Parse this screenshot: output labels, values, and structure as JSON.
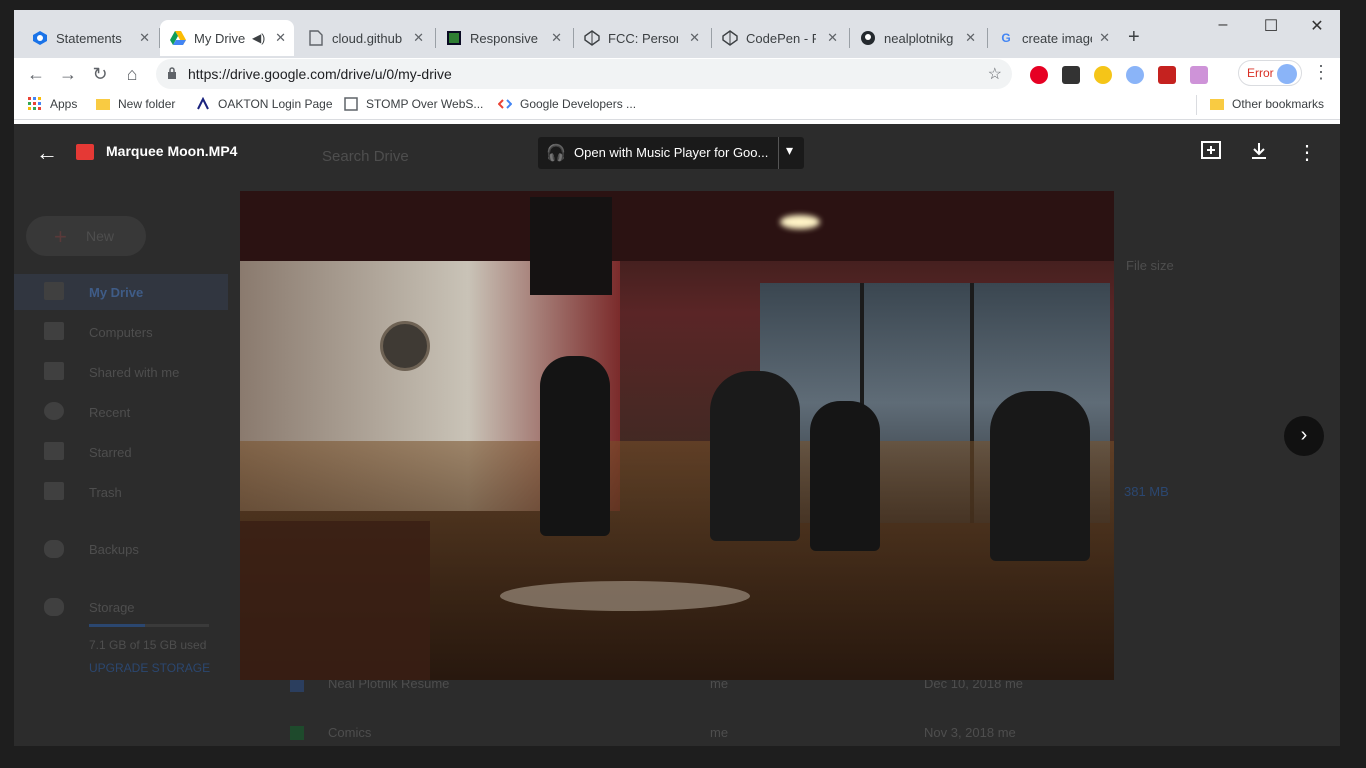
{
  "browser": {
    "tabs": [
      {
        "label": "Statements a",
        "icon": "blue-hex-icon",
        "active": false
      },
      {
        "label": "My Drive",
        "icon": "google-drive-icon",
        "active": true
      },
      {
        "label": "cloud.githubu",
        "icon": "document-icon",
        "active": false
      },
      {
        "label": "Responsive W",
        "icon": "green-square-icon",
        "active": false
      },
      {
        "label": "FCC: Personal",
        "icon": "codepen-icon",
        "active": false
      },
      {
        "label": "CodePen - FC",
        "icon": "codepen-icon",
        "active": false
      },
      {
        "label": "nealplotnikgi",
        "icon": "github-icon",
        "active": false
      },
      {
        "label": "create image",
        "icon": "google-icon",
        "active": false
      }
    ],
    "new_tab": "+",
    "window_controls": {
      "minimize": "–",
      "maximize": "☐",
      "close": "✕"
    },
    "address": "https://drive.google.com/drive/u/0/my-drive",
    "error_chip": "Error",
    "bookmarks": [
      {
        "label": "Apps"
      },
      {
        "label": "New folder"
      },
      {
        "label": "OAKTON Login Page"
      },
      {
        "label": "STOMP Over WebS..."
      },
      {
        "label": "Google Developers ..."
      }
    ],
    "other_bookmarks": "Other bookmarks"
  },
  "viewer": {
    "filename": "Marquee Moon.MP4",
    "open_with": "Open with Music Player for Goo...",
    "icons": {
      "back": "back-arrow-icon",
      "add_to_drive": "add-to-drive-icon",
      "download": "download-icon",
      "more": "more-vert-icon",
      "next": "chevron-right-icon"
    }
  },
  "drive_background": {
    "search_placeholder": "Search Drive",
    "new_button": "New",
    "nav": [
      "My Drive",
      "Computers",
      "Shared with me",
      "Recent",
      "Starred",
      "Trash",
      "Backups",
      "Storage"
    ],
    "storage_used": "7.1 GB of 15 GB used",
    "upgrade": "UPGRADE STORAGE",
    "column_header": "File size",
    "file_size_value": "381 MB",
    "file_rows": [
      {
        "name": "Neal Plotnik Resume",
        "owner": "me",
        "modified": "Dec 10, 2018 me"
      },
      {
        "name": "Comics",
        "owner": "me",
        "modified": "Nov 3, 2018 me"
      }
    ]
  }
}
